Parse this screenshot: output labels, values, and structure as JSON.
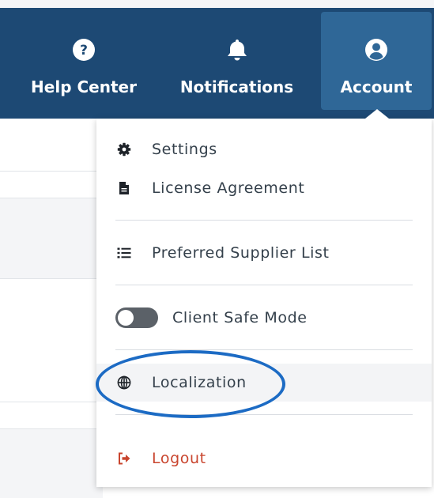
{
  "nav": {
    "help_center_label": "Help Center",
    "notifications_label": "Notifications",
    "account_label": "Account"
  },
  "account_menu": {
    "settings_label": "Settings",
    "license_agreement_label": "License Agreement",
    "preferred_supplier_list_label": "Preferred Supplier List",
    "client_safe_mode_label": "Client Safe Mode",
    "client_safe_mode_on": false,
    "localization_label": "Localization",
    "logout_label": "Logout"
  },
  "icons": {
    "help_center": "help-circle-icon",
    "notifications": "bell-icon",
    "account": "user-circle-icon",
    "settings": "gear-icon",
    "license_agreement": "document-icon",
    "preferred_supplier_list": "list-icon",
    "localization": "globe-icon",
    "logout": "sign-out-icon"
  },
  "colors": {
    "nav_background": "#1d4974",
    "nav_active_background": "#2f6797",
    "logout_red": "#c9452e",
    "annotation_blue": "#1c6bc4",
    "toggle_off": "#5b6168"
  }
}
